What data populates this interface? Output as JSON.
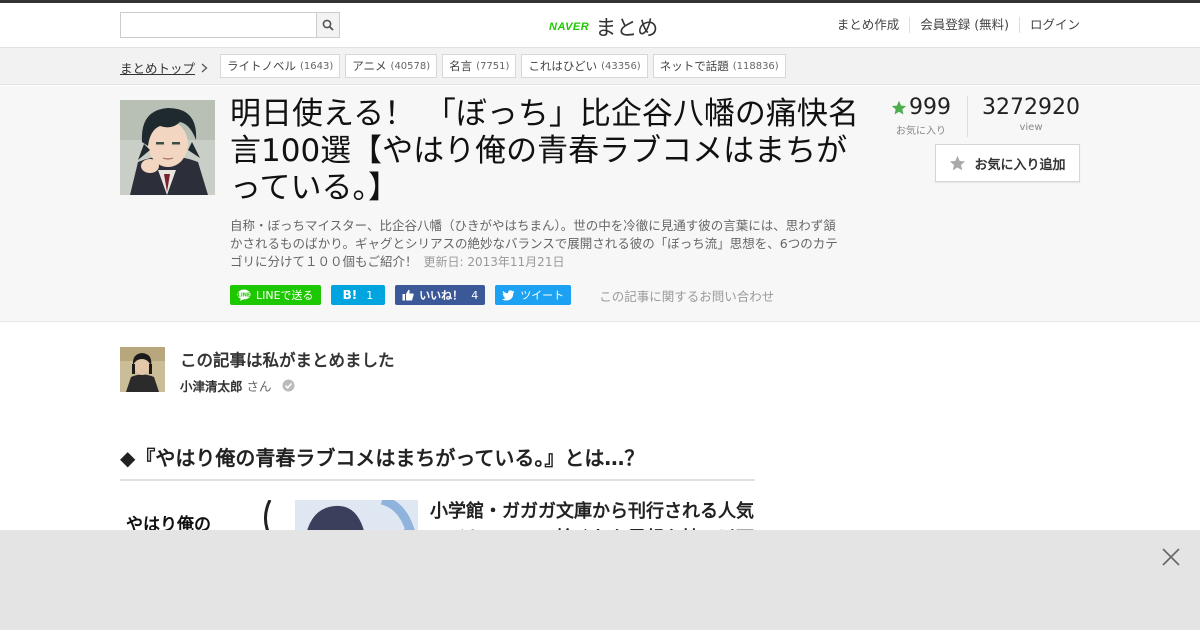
{
  "header": {
    "search_placeholder": "",
    "logo_brand": "NAVER",
    "logo_service": "まとめ",
    "nav": [
      "まとめ作成",
      "会員登録 (無料)",
      "ログイン"
    ]
  },
  "breadcrumb": {
    "top_label": "まとめトップ",
    "tags": [
      {
        "label": "ライトノベル",
        "count": "(1643)"
      },
      {
        "label": "アニメ",
        "count": "(40578)"
      },
      {
        "label": "名言",
        "count": "(7751)"
      },
      {
        "label": "これはひどい",
        "count": "(43356)"
      },
      {
        "label": "ネットで話題",
        "count": "(118836)"
      }
    ]
  },
  "article": {
    "title": "明日使える！ 「ぼっち」比企谷八幡の痛快名言100選【やはり俺の青春ラブコメはまちがっている。】",
    "description": "自称・ぼっちマイスター、比企谷八幡（ひきがやはちまん）。世の中を冷徹に見通す彼の言葉には、思わず頷かされるものばかり。ギャグとシリアスの絶妙なバランスで展開される彼の「ぼっち流」思想を、6つのカテゴリに分けて１００個もご紹介！",
    "updated": "更新日: 2013年11月21日",
    "favorites": "999",
    "favorites_label": "お気に入り",
    "views": "3272920",
    "views_label": "view",
    "fav_button": "お気に入り追加"
  },
  "share": {
    "line": "LINEで送る",
    "hatena_icon": "B!",
    "hatena_count": "1",
    "fb_label": "いいね！",
    "fb_count": "4",
    "tweet": "ツイート",
    "inquiry": "この記事に関するお問い合わせ"
  },
  "author": {
    "heading": "この記事は私がまとめました",
    "name": "小津清太郎",
    "suffix": "さん"
  },
  "content": {
    "section_heading": "◆『やはり俺の青春ラブコメはまちがっている。』とは…？",
    "lead_text": "小学館・ガガガ文庫から刊行される人気ライトノベル。捻くれた思想を持つ以下",
    "image_text": "やはり俺の"
  },
  "colors": {
    "accent_green": "#1ec800",
    "star_green": "#4cae4c",
    "fb_blue": "#3b5998",
    "tw_blue": "#1da1f2",
    "hatena_blue": "#00a4de"
  }
}
